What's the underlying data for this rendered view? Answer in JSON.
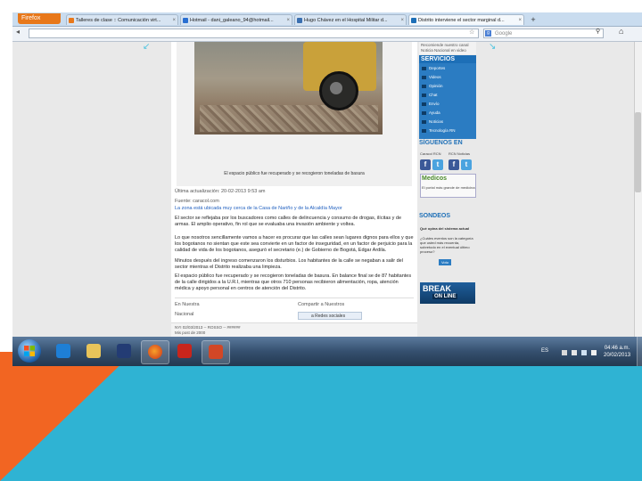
{
  "browser": {
    "app_button": "Firefox",
    "tabs": [
      {
        "title": "Talleres de clase :: Comunicación virt..."
      },
      {
        "title": "Hotmail - dani_galeano_94@hotmail..."
      },
      {
        "title": "Hugo Chávez en el Hospital Militar d..."
      },
      {
        "title": "Distrito interviene el sector marginal d..."
      }
    ],
    "url": "",
    "search_placeholder": "Google"
  },
  "article": {
    "caption": "El espacio público fue recuperado y se recogieron toneladas de basura",
    "updated": "Última actualización: 20-02-2013 9:53 am",
    "source": "Fuente: caracol.com",
    "subtitle": "La zona está ubicada muy cerca de la Casa de Nariño y de la Alcaldía Mayor",
    "paragraphs": [
      "El sector se reflejaba por los buscadores como calles de delincuencia y consumo de drogas, ilícitas y de armas. El amplio operativo, fin rol que se evaluaba una invasión ambiente y voltea.",
      "Lo que nosotros sencillamente vamos a hacer es procurar que las calles sean lugares dignos para ellos y que los bogotanos no sientan que este sea convierte en un factor de inseguridad, en un factor de perjuicio para la calidad de vida de los bogotanos, aseguró el secretario (e.) de Gobierno de Bogotá, Edgar Ardila.",
      "Minutos después del ingreso comenzaron los disturbios. Los habitantes de la calle se negaban a salir del sector mientras el Distrito realizaba una limpieza.",
      "El espacio público fue recuperado y se recogieron toneladas de basura. En balance final se de 87 habitantes de la calle dirigidos a la U.R.I, mientras que otros 710 personas recibieron alimentación, ropa, atención médica y apoyo personal en centros de atención del Distrito."
    ],
    "section_label": "En Nuestra",
    "section_value": "Nacional",
    "share_title": "Compartir a Nuestros",
    "share_button": "a Redes sociales",
    "comments_label": "NYI 02/03/2013 -- ROSSO -- ######",
    "comments_sub": "Mis post de 2000"
  },
  "sidebar": {
    "top_text": "Recomiende nuestro canal Noticia Nacional en video",
    "services_title": "SERVICIOS",
    "services": [
      "Deportes",
      "Videos",
      "Opinión",
      "Chat",
      "Envío",
      "Ayuda",
      "Noticias",
      "Tecnología RN"
    ],
    "follow_title": "SÍGUENOS EN",
    "follow_labels": [
      "Caracol RCN",
      "RCN Noticias"
    ],
    "medicos_title": "Medicos",
    "medicos_sub": "El portal más grande de medicina",
    "polls_title": "SONDEOS",
    "polls_question": "Qué opina del sistema actual",
    "polls_text": "¿Cuáles eventos son la categoría que usted más recuerda, sobretodo en el eventual último proceso?",
    "vote_button": "Voto",
    "break_title": "BREAK",
    "break_sub": "ON LINE"
  },
  "taskbar": {
    "lang": "ES",
    "time": "04:46 a.m.",
    "date": "20/02/2013"
  },
  "colors": {
    "slide_bottom": "#2fb3d3",
    "slide_accent": "#f26522",
    "site_blue": "#1d6fb7",
    "firefox_orange": "#e8781a"
  }
}
